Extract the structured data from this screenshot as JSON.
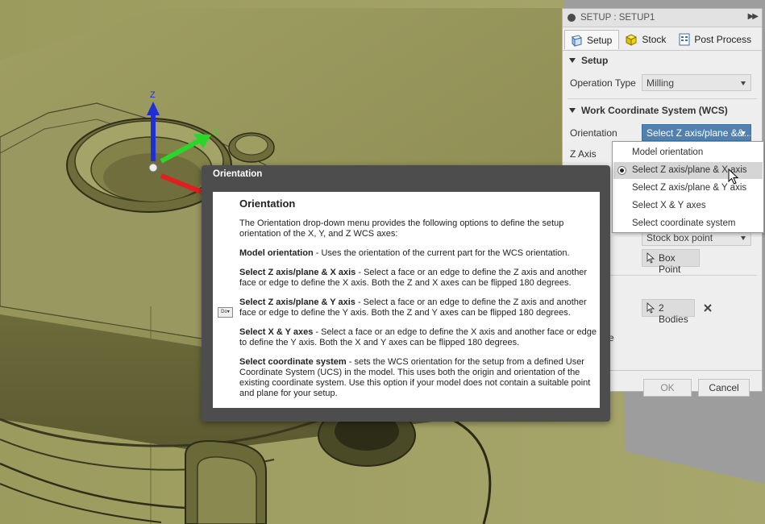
{
  "panel": {
    "title": "SETUP : SETUP1",
    "tabs": [
      {
        "label": "Setup",
        "icon": "setup-icon",
        "active": true
      },
      {
        "label": "Stock",
        "icon": "stock-cube-icon",
        "active": false
      },
      {
        "label": "Post Process",
        "icon": "post-process-icon",
        "active": false
      }
    ],
    "setup_section": {
      "heading": "Setup",
      "operation_type_label": "Operation Type",
      "operation_type_value": "Milling"
    },
    "wcs_section": {
      "heading": "Work Coordinate System (WCS)",
      "orientation_label": "Orientation",
      "orientation_value": "Select Z axis/plane &&...",
      "z_axis_label": "Z Axis"
    },
    "origin_value": "Stock box point",
    "box_point_label": "Box Point",
    "bodies_label": "2 Bodies",
    "partial_label": "e",
    "ok_label": "OK",
    "cancel_label": "Cancel"
  },
  "dropdown": {
    "items": [
      "Model orientation",
      "Select Z axis/plane & X axis",
      "Select Z axis/plane & Y axis",
      "Select X & Y axes",
      "Select coordinate system"
    ],
    "selected_index": 1
  },
  "tooltip": {
    "window_title": "Orientation",
    "heading": "Orientation",
    "intro": "The Orientation drop-down menu provides the following options to define the setup orientation of the X, Y, and Z WCS axes:",
    "options": [
      {
        "term": "Model orientation",
        "desc": " - Uses the orientation of the current part for the WCS orientation."
      },
      {
        "term": "Select Z axis/plane & X axis",
        "desc": " - Select a face or an edge to define the Z axis and another face or edge to define the X axis. Both the Z and X axes can be flipped 180 degrees."
      },
      {
        "term": "Select Z axis/plane & Y axis",
        "desc": " - Select a face or an edge to define the Z axis and another face or edge to define the Y axis. Both the Z and Y axes can be flipped 180 degrees."
      },
      {
        "term": "Select X & Y axes",
        "desc": " - Select a face or an edge to define the X axis and another face or edge to define the Y axis. Both the X and Y axes can be flipped 180 degrees."
      },
      {
        "term": "Select coordinate system",
        "desc": " - sets the WCS orientation for the setup from a defined User Coordinate System (UCS) in the model. This uses both the origin and orientation of the existing coordinate system. Use this option if your model does not contain a suitable point and plane for your setup."
      }
    ],
    "thumb_label": "Do"
  },
  "triad": {
    "z_label": "Z",
    "y_label": "Y"
  },
  "colors": {
    "model_olive": "#8e8d52",
    "model_edge": "#3d3c22",
    "accent_blue": "#4f82b3",
    "axis_z": "#1f2fd8",
    "axis_y": "#2bd62b",
    "axis_x": "#e02020"
  }
}
